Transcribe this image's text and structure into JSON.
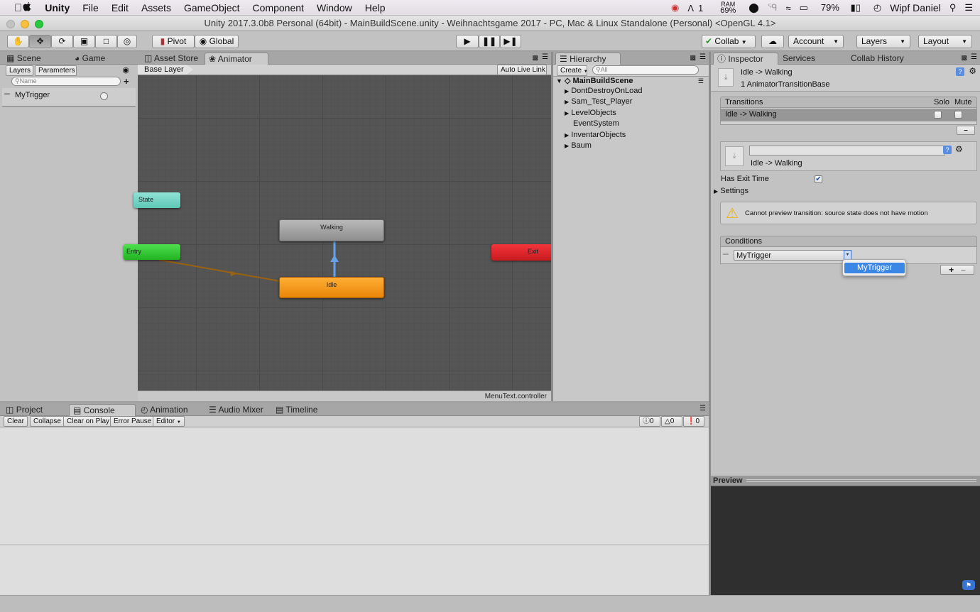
{
  "menubar": {
    "apple": "",
    "items": [
      "Unity",
      "File",
      "Edit",
      "Assets",
      "GameObject",
      "Component",
      "Window",
      "Help"
    ],
    "status": {
      "dropbox": "1",
      "ram_label": "RAM",
      "ram_value": "69%",
      "battery": "79%",
      "user": "Wipf Daniel"
    }
  },
  "window": {
    "title": "Unity 2017.3.0b8 Personal (64bit) - MainBuildScene.unity - Weihnachtsgame 2017 - PC, Mac & Linux Standalone (Personal) <OpenGL 4.1>"
  },
  "toolbar": {
    "pivot": "Pivot",
    "global": "Global",
    "collab": "Collab",
    "account": "Account",
    "layers": "Layers",
    "layout": "Layout"
  },
  "left": {
    "tabs": [
      "Scene",
      "Game"
    ],
    "subtabs": [
      "Layers",
      "Parameters"
    ],
    "search_placeholder": "Name",
    "param": "MyTrigger"
  },
  "animator": {
    "tabs": [
      "Asset Store",
      "Animator"
    ],
    "breadcrumb": "Base Layer",
    "live_link": "Auto Live Link",
    "footer": "MenuText.controller",
    "nodes": {
      "any": "State",
      "entry": "Entry",
      "walking": "Walking",
      "idle": "Idle",
      "exit": "Exit"
    }
  },
  "hierarchy": {
    "tab": "Hierarchy",
    "create": "Create",
    "search_placeholder": "All",
    "scene": "MainBuildScene",
    "items": [
      "DontDestroyOnLoad",
      "Sam_Test_Player",
      "LevelObjects",
      "EventSystem",
      "InventarObjects",
      "Baum"
    ]
  },
  "inspector": {
    "tabs": [
      "Inspector",
      "Services",
      "Collab History"
    ],
    "header_title": "Idle -> Walking",
    "header_sub": "1 AnimatorTransitionBase",
    "transitions_label": "Transitions",
    "solo": "Solo",
    "mute": "Mute",
    "transition_row": "Idle -> Walking",
    "transition_name": "Idle -> Walking",
    "has_exit_time": "Has Exit Time",
    "settings": "Settings",
    "warning": "Cannot preview transition: source state does not have motion",
    "conditions_label": "Conditions",
    "condition_value": "MyTrigger",
    "dropdown_option": "MyTrigger",
    "preview": "Preview"
  },
  "bottom": {
    "tabs": [
      "Project",
      "Console",
      "Animation",
      "Audio Mixer",
      "Timeline"
    ],
    "buttons": [
      "Clear",
      "Collapse",
      "Clear on Play",
      "Error Pause",
      "Editor"
    ],
    "counts": [
      "0",
      "0",
      "0"
    ]
  },
  "colors": {
    "accent_blue": "#3b87e6",
    "entry_green": "#2ec52e",
    "idle_orange": "#f39a1b",
    "exit_red": "#e0242a",
    "any_teal": "#6fd3c1"
  }
}
